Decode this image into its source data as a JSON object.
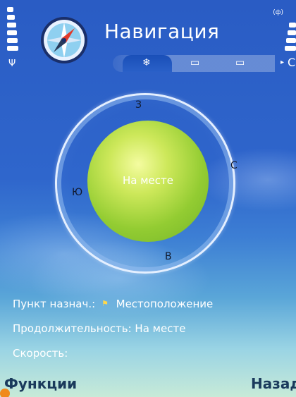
{
  "header": {
    "title": "Навигация",
    "app_icon": "compass-icon",
    "signal_icon": "signal-strength-icon",
    "battery_icon": "battery-level-icon",
    "antenna_icon": "antenna-icon",
    "network_indicator": "(ф)"
  },
  "tabs": {
    "items": [
      {
        "icon": "compass-rose-icon",
        "glyph": "❄",
        "active": true
      },
      {
        "icon": "map-tab-icon",
        "glyph": "▭",
        "active": false
      },
      {
        "icon": "monitor-tab-icon",
        "glyph": "▭",
        "active": false
      }
    ],
    "scroll_arrow": "▸",
    "more": "С"
  },
  "compass": {
    "status": "На месте",
    "directions": {
      "top": "З",
      "right": "С",
      "left": "Ю",
      "bottom": "В"
    }
  },
  "info": {
    "destination_label": "Пункт назнач.:",
    "destination_value": "Местоположение",
    "duration_label": "Продолжительность:",
    "duration_value": "На месте",
    "speed_label": "Скорость:"
  },
  "softkeys": {
    "left": "Функции",
    "right": "Назад"
  },
  "colors": {
    "background_top": "#2a5cc4",
    "background_bottom": "#c7ead8",
    "ball": "#93cc32",
    "softkey_text": "#1a3a5c",
    "badge": "#f08a1c"
  }
}
